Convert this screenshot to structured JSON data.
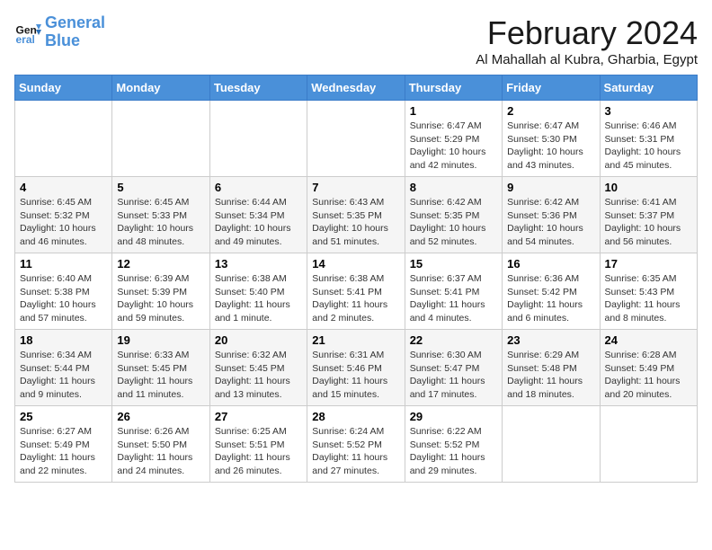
{
  "logo": {
    "text_general": "General",
    "text_blue": "Blue"
  },
  "title": "February 2024",
  "location": "Al Mahallah al Kubra, Gharbia, Egypt",
  "days_of_week": [
    "Sunday",
    "Monday",
    "Tuesday",
    "Wednesday",
    "Thursday",
    "Friday",
    "Saturday"
  ],
  "weeks": [
    [
      {
        "day": "",
        "info": ""
      },
      {
        "day": "",
        "info": ""
      },
      {
        "day": "",
        "info": ""
      },
      {
        "day": "",
        "info": ""
      },
      {
        "day": "1",
        "info": "Sunrise: 6:47 AM\nSunset: 5:29 PM\nDaylight: 10 hours\nand 42 minutes."
      },
      {
        "day": "2",
        "info": "Sunrise: 6:47 AM\nSunset: 5:30 PM\nDaylight: 10 hours\nand 43 minutes."
      },
      {
        "day": "3",
        "info": "Sunrise: 6:46 AM\nSunset: 5:31 PM\nDaylight: 10 hours\nand 45 minutes."
      }
    ],
    [
      {
        "day": "4",
        "info": "Sunrise: 6:45 AM\nSunset: 5:32 PM\nDaylight: 10 hours\nand 46 minutes."
      },
      {
        "day": "5",
        "info": "Sunrise: 6:45 AM\nSunset: 5:33 PM\nDaylight: 10 hours\nand 48 minutes."
      },
      {
        "day": "6",
        "info": "Sunrise: 6:44 AM\nSunset: 5:34 PM\nDaylight: 10 hours\nand 49 minutes."
      },
      {
        "day": "7",
        "info": "Sunrise: 6:43 AM\nSunset: 5:35 PM\nDaylight: 10 hours\nand 51 minutes."
      },
      {
        "day": "8",
        "info": "Sunrise: 6:42 AM\nSunset: 5:35 PM\nDaylight: 10 hours\nand 52 minutes."
      },
      {
        "day": "9",
        "info": "Sunrise: 6:42 AM\nSunset: 5:36 PM\nDaylight: 10 hours\nand 54 minutes."
      },
      {
        "day": "10",
        "info": "Sunrise: 6:41 AM\nSunset: 5:37 PM\nDaylight: 10 hours\nand 56 minutes."
      }
    ],
    [
      {
        "day": "11",
        "info": "Sunrise: 6:40 AM\nSunset: 5:38 PM\nDaylight: 10 hours\nand 57 minutes."
      },
      {
        "day": "12",
        "info": "Sunrise: 6:39 AM\nSunset: 5:39 PM\nDaylight: 10 hours\nand 59 minutes."
      },
      {
        "day": "13",
        "info": "Sunrise: 6:38 AM\nSunset: 5:40 PM\nDaylight: 11 hours\nand 1 minute."
      },
      {
        "day": "14",
        "info": "Sunrise: 6:38 AM\nSunset: 5:41 PM\nDaylight: 11 hours\nand 2 minutes."
      },
      {
        "day": "15",
        "info": "Sunrise: 6:37 AM\nSunset: 5:41 PM\nDaylight: 11 hours\nand 4 minutes."
      },
      {
        "day": "16",
        "info": "Sunrise: 6:36 AM\nSunset: 5:42 PM\nDaylight: 11 hours\nand 6 minutes."
      },
      {
        "day": "17",
        "info": "Sunrise: 6:35 AM\nSunset: 5:43 PM\nDaylight: 11 hours\nand 8 minutes."
      }
    ],
    [
      {
        "day": "18",
        "info": "Sunrise: 6:34 AM\nSunset: 5:44 PM\nDaylight: 11 hours\nand 9 minutes."
      },
      {
        "day": "19",
        "info": "Sunrise: 6:33 AM\nSunset: 5:45 PM\nDaylight: 11 hours\nand 11 minutes."
      },
      {
        "day": "20",
        "info": "Sunrise: 6:32 AM\nSunset: 5:45 PM\nDaylight: 11 hours\nand 13 minutes."
      },
      {
        "day": "21",
        "info": "Sunrise: 6:31 AM\nSunset: 5:46 PM\nDaylight: 11 hours\nand 15 minutes."
      },
      {
        "day": "22",
        "info": "Sunrise: 6:30 AM\nSunset: 5:47 PM\nDaylight: 11 hours\nand 17 minutes."
      },
      {
        "day": "23",
        "info": "Sunrise: 6:29 AM\nSunset: 5:48 PM\nDaylight: 11 hours\nand 18 minutes."
      },
      {
        "day": "24",
        "info": "Sunrise: 6:28 AM\nSunset: 5:49 PM\nDaylight: 11 hours\nand 20 minutes."
      }
    ],
    [
      {
        "day": "25",
        "info": "Sunrise: 6:27 AM\nSunset: 5:49 PM\nDaylight: 11 hours\nand 22 minutes."
      },
      {
        "day": "26",
        "info": "Sunrise: 6:26 AM\nSunset: 5:50 PM\nDaylight: 11 hours\nand 24 minutes."
      },
      {
        "day": "27",
        "info": "Sunrise: 6:25 AM\nSunset: 5:51 PM\nDaylight: 11 hours\nand 26 minutes."
      },
      {
        "day": "28",
        "info": "Sunrise: 6:24 AM\nSunset: 5:52 PM\nDaylight: 11 hours\nand 27 minutes."
      },
      {
        "day": "29",
        "info": "Sunrise: 6:22 AM\nSunset: 5:52 PM\nDaylight: 11 hours\nand 29 minutes."
      },
      {
        "day": "",
        "info": ""
      },
      {
        "day": "",
        "info": ""
      }
    ]
  ]
}
